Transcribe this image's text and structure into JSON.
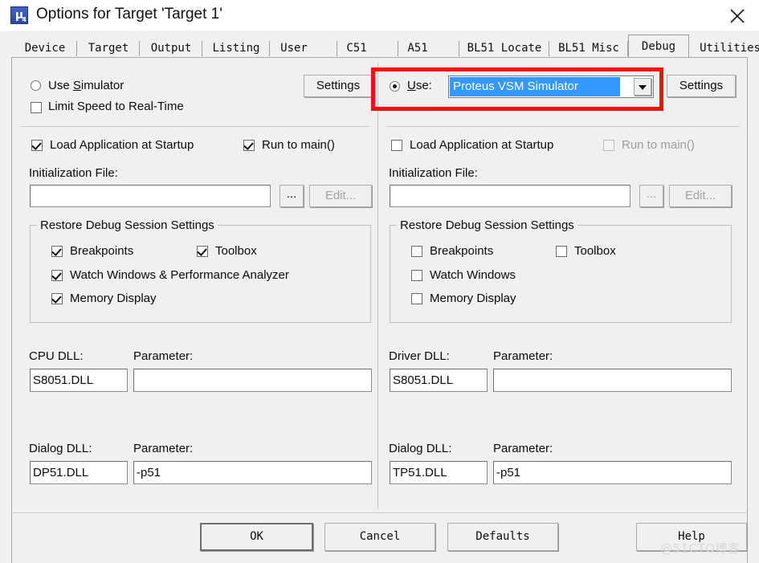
{
  "window": {
    "title": "Options for Target 'Target 1'",
    "app_icon": "uvision4-icon",
    "close_label": "close-icon"
  },
  "tabs": [
    {
      "label": "Device",
      "active": false
    },
    {
      "label": "Target",
      "active": false
    },
    {
      "label": "Output",
      "active": false
    },
    {
      "label": "Listing",
      "active": false
    },
    {
      "label": "User",
      "active": false
    },
    {
      "label": "C51",
      "active": false
    },
    {
      "label": "A51",
      "active": false
    },
    {
      "label": "BL51 Locate",
      "active": false
    },
    {
      "label": "BL51 Misc",
      "active": false
    },
    {
      "label": "Debug",
      "active": true
    },
    {
      "label": "Utilities",
      "active": false
    }
  ],
  "left_panel": {
    "use_simulator_label": "Use Simulator",
    "use_simulator_accel": "S",
    "use_simulator_checked": false,
    "limit_speed_label": "Limit Speed to Real-Time",
    "limit_speed_checked": false,
    "settings_button": "Settings",
    "load_app_label": "Load Application at Startup",
    "load_app_checked": true,
    "run_to_main_label": "Run to main()",
    "run_to_main_checked": true,
    "init_file_label": "Initialization File:",
    "init_file_value": "",
    "browse_button": "...",
    "edit_button": "Edit...",
    "restore_group_title": "Restore Debug Session Settings",
    "restore_items": [
      {
        "label": "Breakpoints",
        "checked": true
      },
      {
        "label": "Toolbox",
        "checked": true
      },
      {
        "label": "Watch Windows & Performance Analyzer",
        "checked": true
      },
      {
        "label": "Memory Display",
        "checked": true
      }
    ],
    "cpu_dll_label": "CPU DLL:",
    "cpu_dll_value": "S8051.DLL",
    "cpu_param_label": "Parameter:",
    "cpu_param_value": "",
    "dialog_dll_label": "Dialog DLL:",
    "dialog_dll_value": "DP51.DLL",
    "dialog_param_label": "Parameter:",
    "dialog_param_value": "-p51"
  },
  "right_panel": {
    "use_label": "Use:",
    "use_accel": "U",
    "use_checked": true,
    "driver_selected": "Proteus VSM Simulator",
    "driver_options": [
      "Proteus VSM Simulator"
    ],
    "settings_button": "Settings",
    "load_app_label": "Load Application at Startup",
    "load_app_checked": false,
    "run_to_main_label": "Run to main()",
    "run_to_main_checked": false,
    "run_to_main_disabled": true,
    "init_file_label": "Initialization File:",
    "init_file_value": "",
    "browse_button": "...",
    "edit_button": "Edit...",
    "restore_group_title": "Restore Debug Session Settings",
    "restore_items": [
      {
        "label": "Breakpoints",
        "checked": false
      },
      {
        "label": "Toolbox",
        "checked": false
      },
      {
        "label": "Watch Windows",
        "checked": false
      },
      {
        "label": "Memory Display",
        "checked": false
      }
    ],
    "driver_dll_label": "Driver DLL:",
    "driver_dll_value": "S8051.DLL",
    "driver_param_label": "Parameter:",
    "driver_param_value": "",
    "dialog_dll_label": "Dialog DLL:",
    "dialog_dll_value": "TP51.DLL",
    "dialog_param_label": "Parameter:",
    "dialog_param_value": "-p51"
  },
  "footer": {
    "ok": "OK",
    "cancel": "Cancel",
    "defaults": "Defaults",
    "help": "Help"
  },
  "watermark": "@51CTO博客",
  "colors": {
    "accent_selection": "#3399ff",
    "annotation": "#fb0d0d",
    "dialog_bg": "#f0f0f0"
  }
}
